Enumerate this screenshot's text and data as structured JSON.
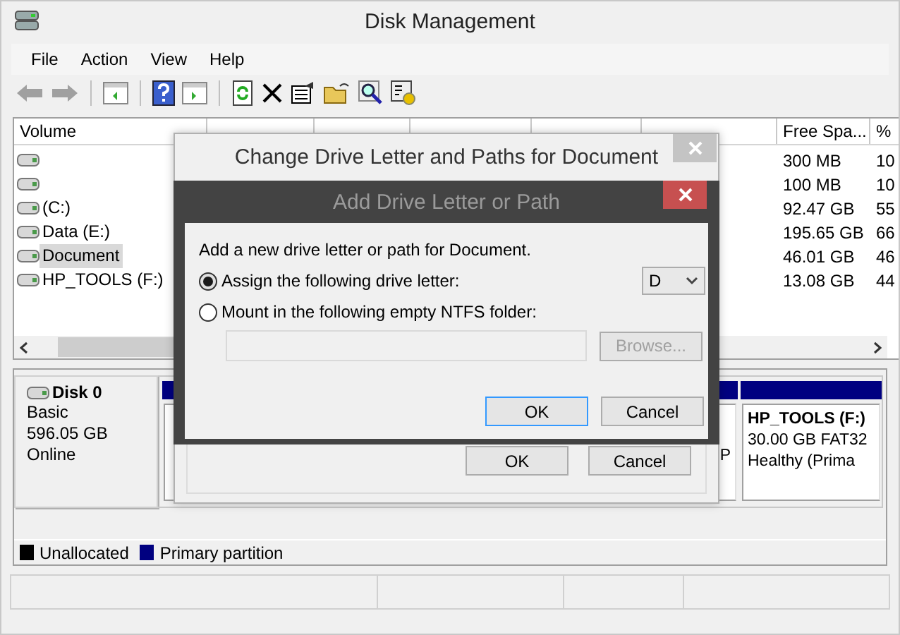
{
  "window": {
    "title": "Disk Management"
  },
  "menu": [
    "File",
    "Action",
    "View",
    "Help"
  ],
  "volume_table": {
    "columns": [
      "Volume",
      "Free Spa...",
      "%"
    ],
    "rows": [
      {
        "volume": "",
        "free_space": "300 MB",
        "percent_free": "10",
        "selected": false
      },
      {
        "volume": "",
        "free_space": "100 MB",
        "percent_free": "10",
        "selected": false
      },
      {
        "volume": " (C:)",
        "free_space": "92.47 GB",
        "percent_free": "55",
        "selected": false
      },
      {
        "volume": "Data (E:)",
        "free_space": "195.65 GB",
        "percent_free": "66",
        "selected": false
      },
      {
        "volume": "Document",
        "free_space": "46.01 GB",
        "percent_free": "46",
        "selected": true
      },
      {
        "volume": "HP_TOOLS (F:)",
        "free_space": "13.08 GB",
        "percent_free": "44",
        "selected": false
      }
    ]
  },
  "disk_pane": {
    "disk": {
      "name": "Disk 0",
      "type": "Basic",
      "size": "596.05 GB",
      "status": "Online"
    },
    "partition_fragment": "P",
    "partition": {
      "name": "HP_TOOLS  (F:)",
      "size": "30.00 GB FAT32",
      "status": "Healthy (Prima"
    }
  },
  "legend": [
    {
      "label": "Unallocated",
      "color": "#000000"
    },
    {
      "label": "Primary partition",
      "color": "#000080"
    }
  ],
  "outer_dialog": {
    "title": "Change Drive Letter and Paths for Document",
    "buttons": [
      "OK",
      "Cancel"
    ]
  },
  "inner_dialog": {
    "title": "Add Drive Letter or Path",
    "prompt": "Add a new drive letter or path for Document.",
    "options": [
      {
        "label": "Assign the following drive letter:",
        "selected": true
      },
      {
        "label": "Mount in the following empty NTFS folder:",
        "selected": false
      }
    ],
    "drive_letter": "D",
    "folder_field": {
      "disabled": true
    },
    "browse_button": {
      "label": "Browse...",
      "disabled": true
    },
    "buttons": [
      "OK",
      "Cancel"
    ]
  }
}
